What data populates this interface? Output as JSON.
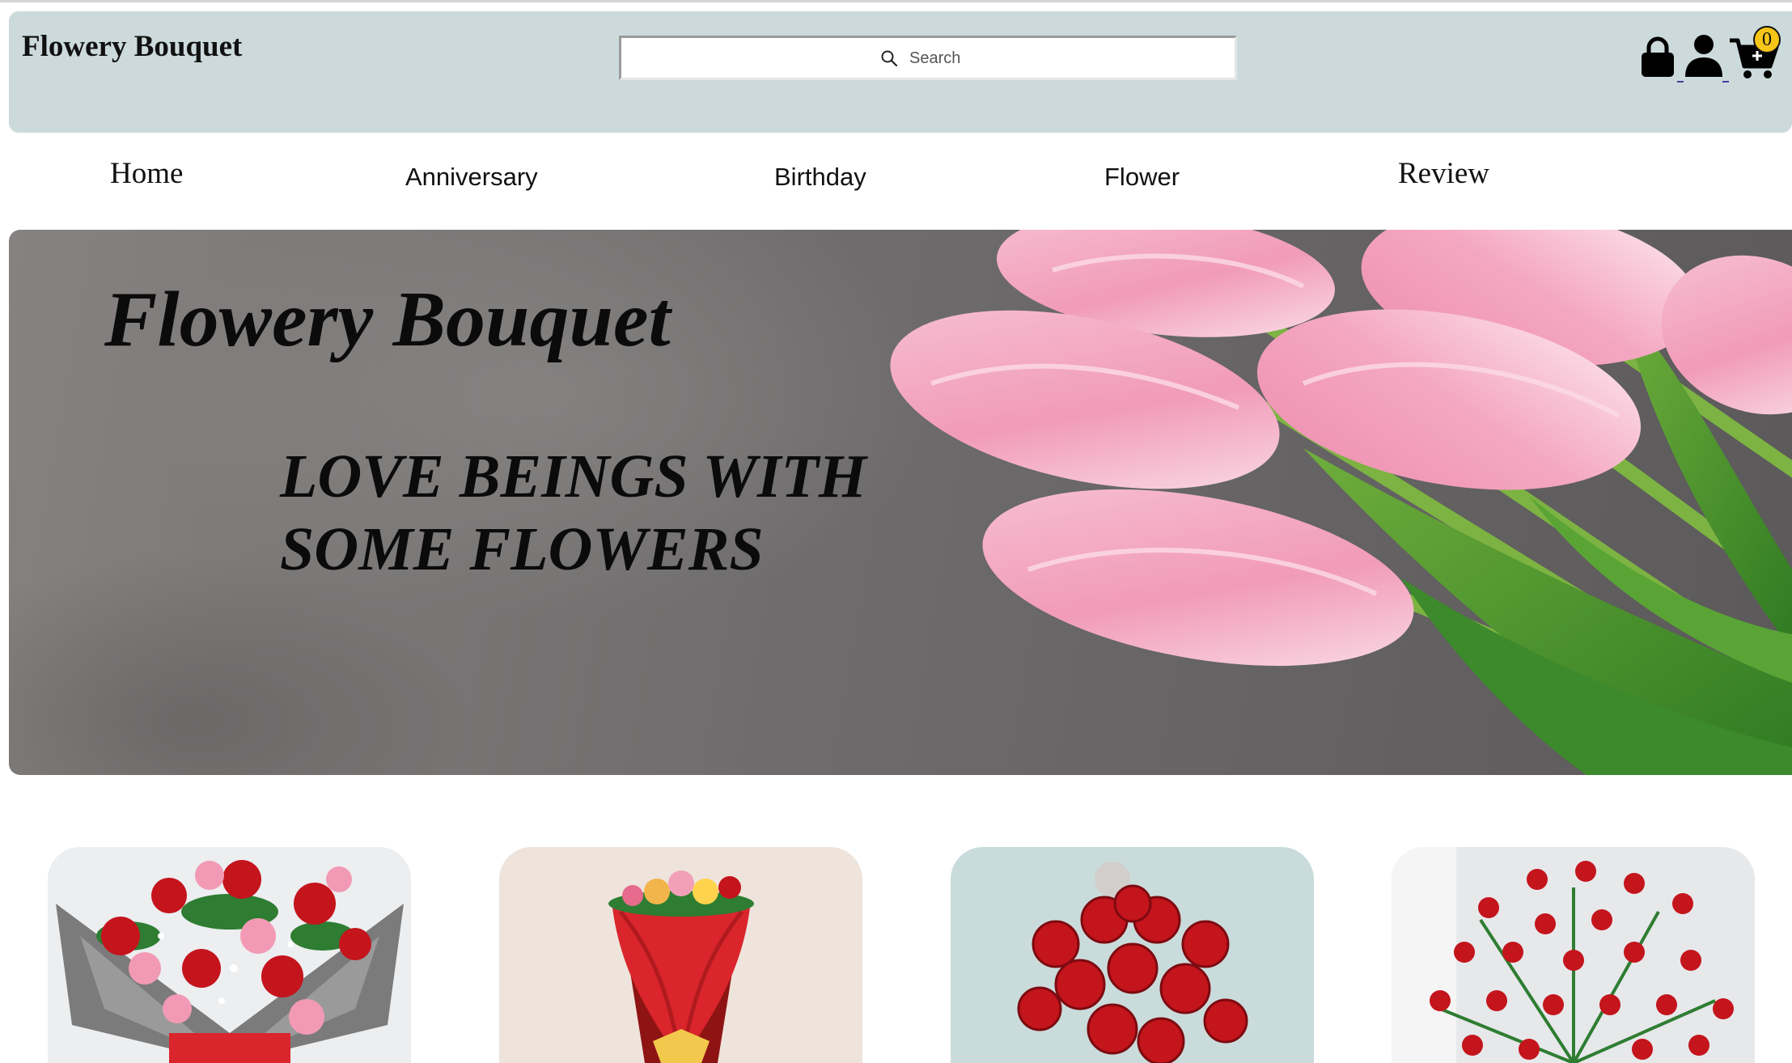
{
  "header": {
    "brand": "Flowery Bouquet",
    "search_placeholder": "Search",
    "cart_count": "0",
    "icons": [
      "lock-icon",
      "user-icon",
      "cart-icon",
      "search-icon"
    ]
  },
  "nav": {
    "items": [
      {
        "label": "Home"
      },
      {
        "label": "Anniversary"
      },
      {
        "label": "Birthday"
      },
      {
        "label": "Flower"
      },
      {
        "label": "Review"
      }
    ]
  },
  "hero": {
    "title": "Flowery Bouquet",
    "tagline_line1": "LOVE BEINGS WITH",
    "tagline_line2": "SOME FLOWERS"
  },
  "colors": {
    "header_bg": "#ccdadb",
    "rose_red": "#c4141c",
    "tulip_pink": "#f3a9c2",
    "cart_badge": "#f5c518"
  }
}
